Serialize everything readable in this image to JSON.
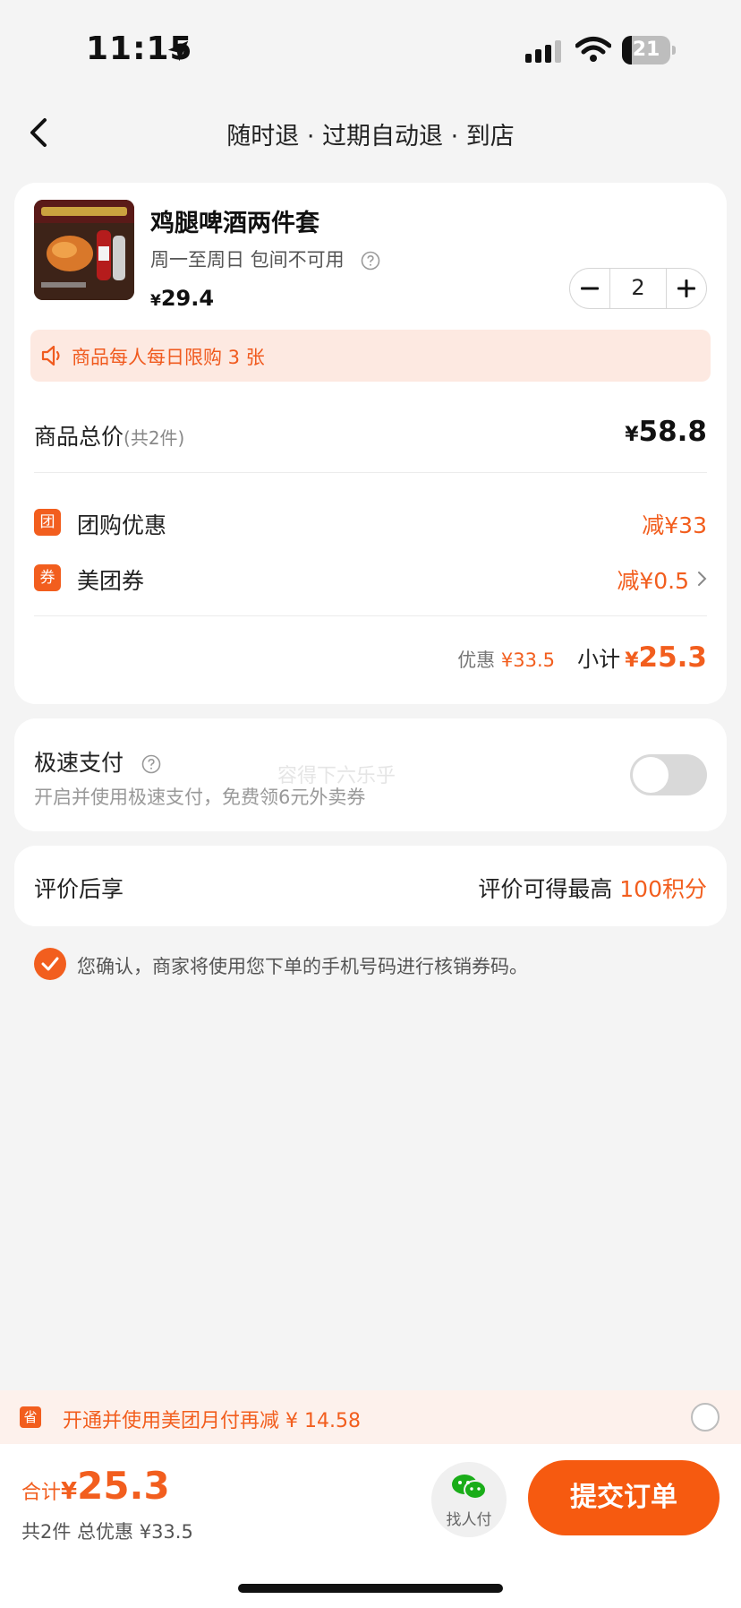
{
  "status_bar": {
    "time": "11:15",
    "battery": "21",
    "battery_level": 0.21
  },
  "nav": {
    "title": "随时退 · 过期自动退 · 到店"
  },
  "product": {
    "name": "鸡腿啤酒两件套",
    "rule": "周一至周日 包间不可用",
    "price_symbol": "¥",
    "price": "29.4",
    "quantity": "2",
    "limit_notice": "商品每人每日限购 3 张"
  },
  "summary": {
    "total_label": "商品总价",
    "total_count": "(共2件)",
    "total_symbol": "¥",
    "total_value": "58.8",
    "discounts": [
      {
        "badge": "团",
        "label": "团购优惠",
        "value": "减¥33"
      },
      {
        "badge": "券",
        "label": "美团券",
        "value": "减¥0.5"
      }
    ],
    "saved_label": "优惠",
    "saved_value": "¥33.5",
    "subtotal_label": "小计",
    "subtotal_symbol": "¥",
    "subtotal_value": "25.3"
  },
  "fast_pay": {
    "title": "极速支付",
    "desc": "开启并使用极速支付，免费领6元外卖券",
    "watermark": "容得下六乐乎",
    "enabled": false
  },
  "review": {
    "title": "评价后享",
    "prefix": "评价可得最高 ",
    "points": "100积分"
  },
  "confirm": {
    "text": "您确认，商家将使用您下单的手机号码进行核销券码。",
    "checked": true
  },
  "promo": {
    "icon": "省",
    "text": "开通并使用美团月付再减 ¥ 14.58"
  },
  "bottom": {
    "total_label": "合计",
    "total_symbol": "¥",
    "total_value": "25.3",
    "total_sub": "共2件  总优惠 ¥33.5",
    "share_label": "找人付",
    "submit_label": "提交订单"
  },
  "colors": {
    "accent": "#f25e1e",
    "limit_bg": "#fde9e1",
    "promo_bg": "#fdf1ec"
  }
}
